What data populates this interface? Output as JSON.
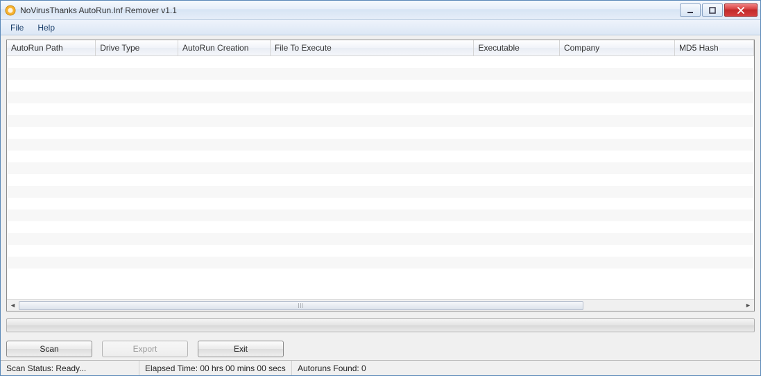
{
  "titlebar": {
    "title": "NoVirusThanks AutoRun.Inf Remover v1.1"
  },
  "menu": {
    "file": "File",
    "help": "Help"
  },
  "columns": {
    "c0": "AutoRun Path",
    "c1": "Drive Type",
    "c2": "AutoRun Creation",
    "c3": "File To Execute",
    "c4": "Executable",
    "c5": "Company",
    "c6": "MD5 Hash"
  },
  "buttons": {
    "scan": "Scan",
    "export": "Export",
    "exit": "Exit"
  },
  "status": {
    "scan_status": "Scan Status: Ready...",
    "elapsed": "Elapsed Time: 00 hrs 00 mins 00 secs",
    "found": "Autoruns Found: 0"
  },
  "rows": []
}
